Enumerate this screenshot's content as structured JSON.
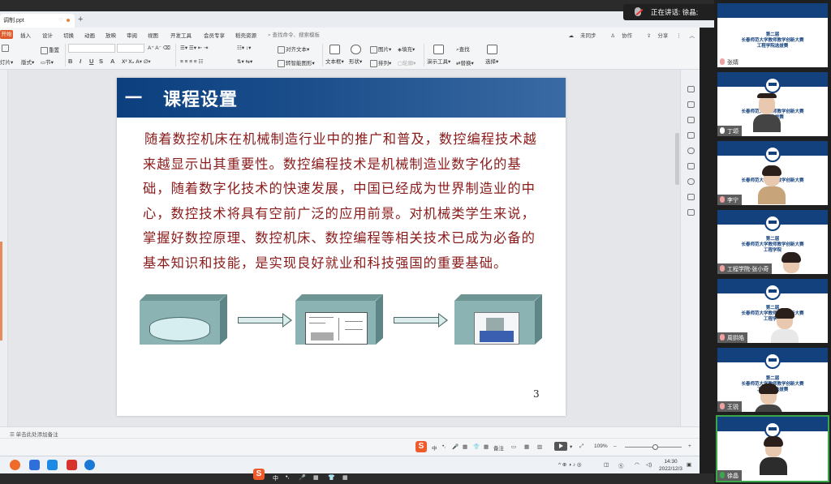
{
  "window": {
    "tab_title": "调制.ppt",
    "speaking_label": "正在讲话: 徐晶;"
  },
  "ribbon": {
    "start_label": "开始",
    "menu_items": [
      "插入",
      "设计",
      "切换",
      "动画",
      "放映",
      "审阅",
      "视图",
      "开发工具",
      "会员专享",
      "稻壳资源"
    ],
    "search_placeholder": "查找命令、搜索模板",
    "unsynced": "未同步",
    "collab": "协作",
    "share": "分享",
    "tools": {
      "reset": "重置",
      "current_slide": "灯片",
      "layout": "版式",
      "section": "节",
      "align_text": "对齐文本",
      "smartart": "转智能图形",
      "textbox": "文本框",
      "shape": "形状",
      "picture": "图片",
      "arrange": "排列",
      "fill": "填充",
      "outline": "轮廓",
      "presentation_tools": "演示工具",
      "find": "查找",
      "replace": "替换",
      "select": "选择"
    }
  },
  "slide": {
    "section_number": "一",
    "section_title": "课程设置",
    "body": "随着数控机床在机械制造行业中的推广和普及，数控编程技术越来越显示出其重要性。数控编程技术是机械制造业数字化的基础，随着数字化技术的快速发展，中国已经成为世界制造业的中心，数控技术将具有空前广泛的应用前景。对机械类学生来说，掌握好数控原理、数控机床、数控编程等相关技术已成为必备的基本知识和技能，是实现良好就业和科技强国的重要基础。",
    "page_number": "3"
  },
  "notes_placeholder": "单击此处添加备注",
  "statusbar": {
    "ime_chars": [
      "中",
      "•,",
      "🎤",
      "▦",
      "👕",
      "▦"
    ],
    "notes_label": "备注",
    "zoom": "109%"
  },
  "taskbar": {
    "ime_chars": [
      "中",
      "•,",
      "🎤",
      "▦",
      "👕",
      "▦"
    ],
    "tray_text": "^ ⊕ ◑ ♪ ◎",
    "time": "14:30",
    "date": "2022/12/3"
  },
  "participants": [
    {
      "name": "张婧",
      "caption": "第二届|长春师范大学教师教学创新大赛|工程学院选拔赛"
    },
    {
      "name": "丁颂",
      "caption": "长春师范大学教师教学创新大赛|学院选拔赛"
    },
    {
      "name": "李宁",
      "caption": "长春师范大学教师教学创新大赛|赛"
    },
    {
      "name": "工程学院-张小奇",
      "caption": "第二届|长春师范大学教师教学创新大赛|工程学院"
    },
    {
      "name": "周拱皓",
      "caption": "第二届|长春师范大学教师教学创新大赛|工程学院"
    },
    {
      "name": "王锐",
      "caption": "第二届|长春师范大学教师教学创新大赛|工程学院选拔赛"
    },
    {
      "name": "徐晶",
      "caption": ""
    }
  ],
  "colors": {
    "accent": "#e05b2b",
    "slide_header": "#0b3f7e",
    "slide_text": "#8b1a1a",
    "box_teal": "#8bb3b3",
    "active_speaker": "#3aa84a"
  }
}
